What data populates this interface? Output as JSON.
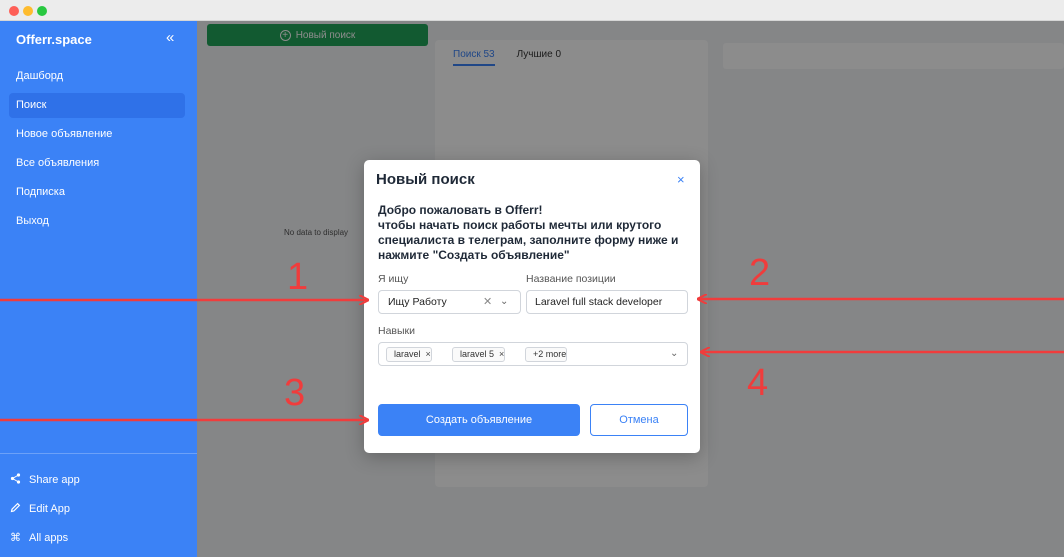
{
  "sidebar": {
    "brand": "Offerr.space",
    "collapse_icon": "«",
    "items": [
      {
        "label": "Дашборд"
      },
      {
        "label": "Поиск",
        "active": true
      },
      {
        "label": "Новое объявление"
      },
      {
        "label": "Все объявления"
      },
      {
        "label": "Подписка"
      },
      {
        "label": "Выход"
      }
    ],
    "bottom": [
      {
        "icon": "share-icon",
        "label": "Share app"
      },
      {
        "icon": "pencil-icon",
        "label": "Edit App"
      },
      {
        "icon": "command-icon",
        "label": "All apps"
      }
    ]
  },
  "main": {
    "new_search_button": "Новый поиск",
    "empty_text": "No data to display",
    "tabs": [
      {
        "label": "Поиск 53",
        "active": true
      },
      {
        "label": "Лучшие 0"
      }
    ]
  },
  "modal": {
    "title": "Новый поиск",
    "close": "×",
    "welcome": "Добро пожаловать в Offerr!\nчтобы начать поиск работы мечты или крутого специалиста в телеграм, заполните форму ниже и нажмите \"Создать объявление\"",
    "looking_for_label": "Я ищу",
    "looking_for_value": "Ищу Работу",
    "position_label": "Название позиции",
    "position_value": "Laravel full stack developer",
    "skills_label": "Навыки",
    "skills": [
      "laravel",
      "laravel 5"
    ],
    "skills_more": "+2 more",
    "submit_label": "Создать объявление",
    "cancel_label": "Отмена"
  },
  "annotations": [
    "1",
    "2",
    "3",
    "4"
  ],
  "colors": {
    "accent": "#3b82f6",
    "annotation": "#f03c3c",
    "new_search_green": "#22a559"
  }
}
